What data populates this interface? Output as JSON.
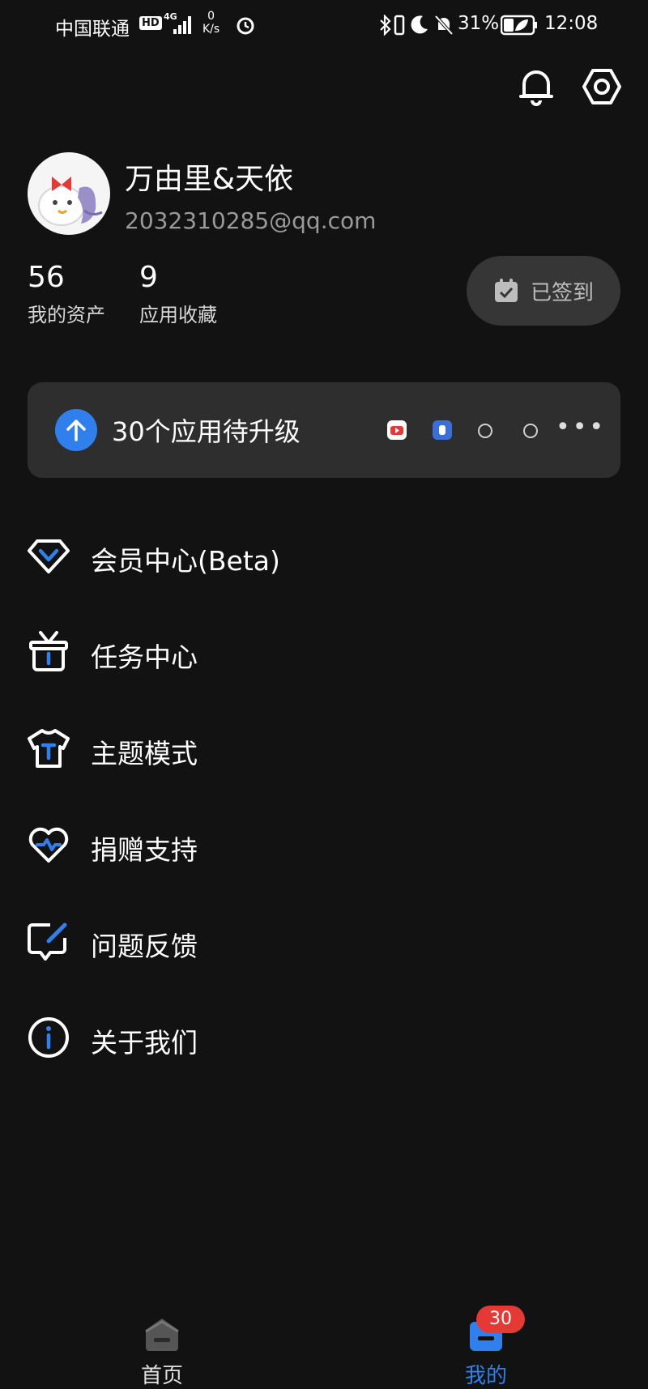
{
  "status_bar": {
    "carrier": "中国联通",
    "network_badge": "HD",
    "network_type": "4G",
    "speed_value": "0",
    "speed_unit": "K/s",
    "battery_percent": "31%",
    "time": "12:08"
  },
  "profile": {
    "username": "万由里&天依",
    "email": "2032310285@qq.com",
    "stats": [
      {
        "value": "56",
        "label": "我的资产"
      },
      {
        "value": "9",
        "label": "应用收藏"
      }
    ],
    "checkin_label": "已签到"
  },
  "update_card": {
    "text": "30个应用待升级",
    "more": "•••"
  },
  "menu": [
    {
      "label": "会员中心(Beta)",
      "icon": "diamond-icon"
    },
    {
      "label": "任务中心",
      "icon": "gift-box-icon"
    },
    {
      "label": "主题模式",
      "icon": "tshirt-icon"
    },
    {
      "label": "捐赠支持",
      "icon": "heart-icon"
    },
    {
      "label": "问题反馈",
      "icon": "feedback-edit-icon"
    },
    {
      "label": "关于我们",
      "icon": "info-icon"
    }
  ],
  "bottom_nav": {
    "items": [
      {
        "label": "首页",
        "icon": "home-icon",
        "active": false
      },
      {
        "label": "我的",
        "icon": "profile-box-icon",
        "active": true
      }
    ],
    "badge": "30"
  },
  "colors": {
    "background": "#121212",
    "card": "#2e2e2e",
    "accent": "#2f80ed",
    "badge": "#e53935",
    "muted_text": "#9a9a9a"
  }
}
